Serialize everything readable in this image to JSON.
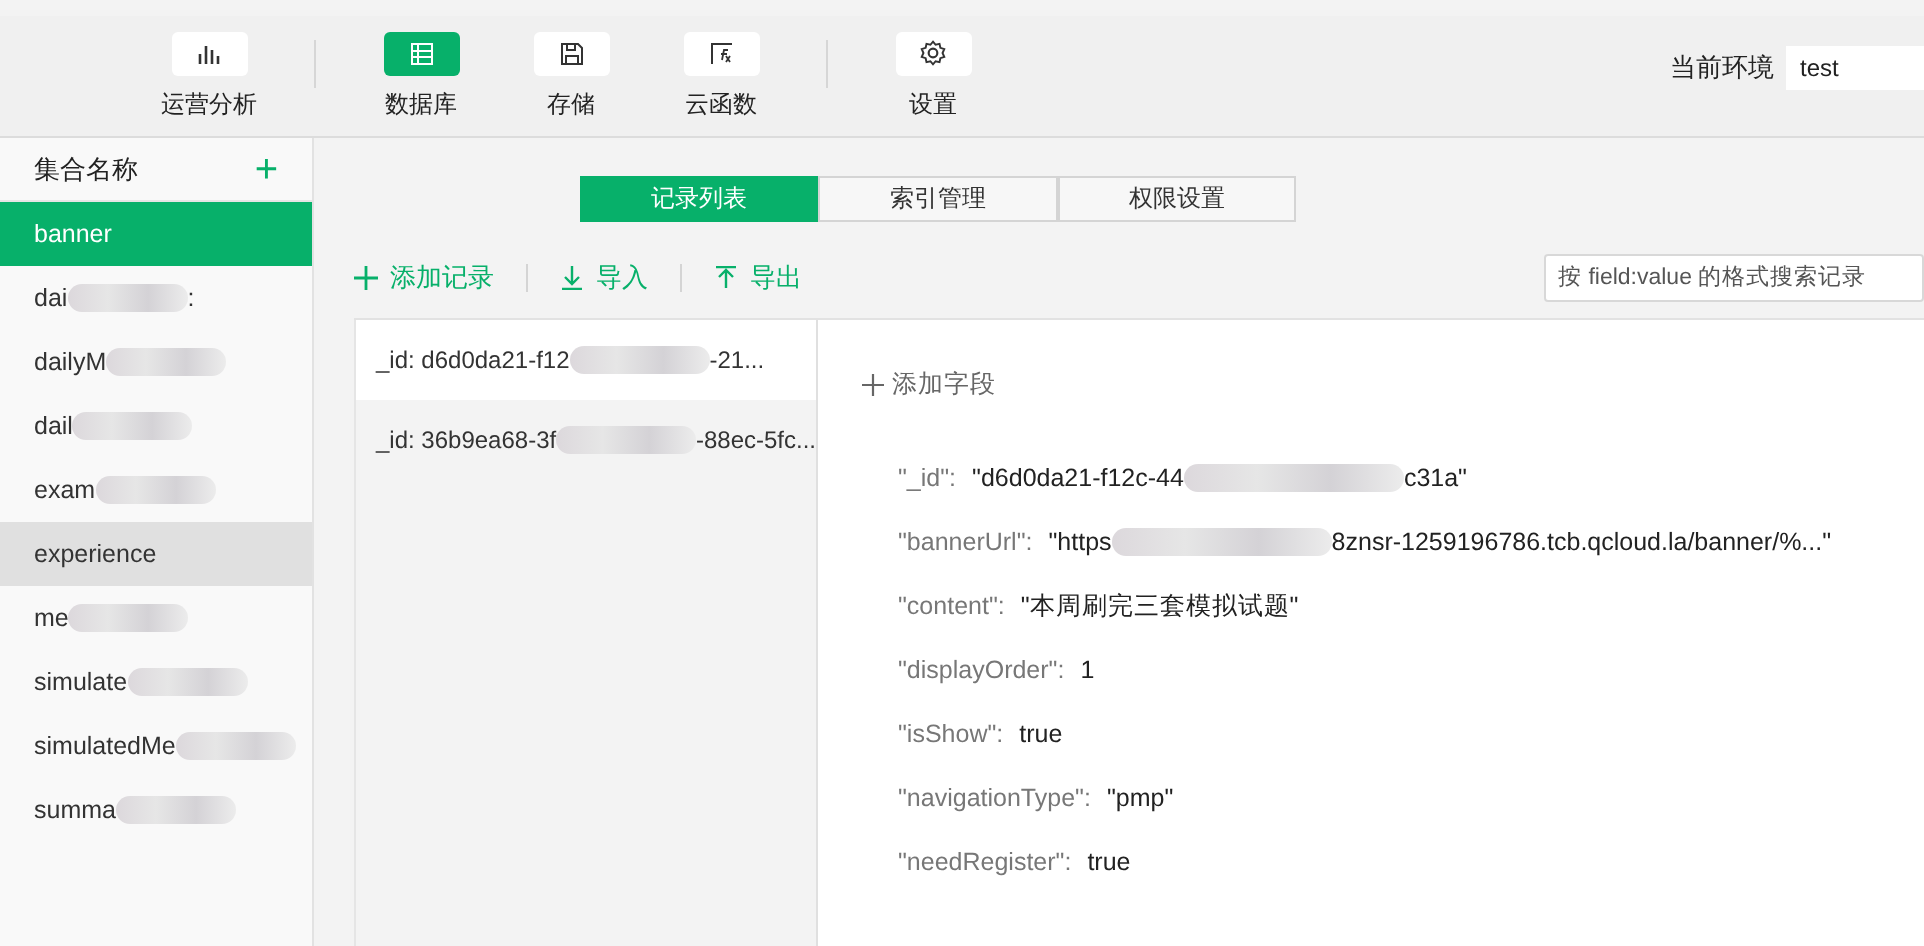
{
  "nav": [
    {
      "label": "运营分析",
      "kind": "chart",
      "selected": false
    },
    {
      "label": "数据库",
      "kind": "database",
      "selected": true
    },
    {
      "label": "存储",
      "kind": "storage",
      "selected": false
    },
    {
      "label": "云函数",
      "kind": "function",
      "selected": false
    },
    {
      "label": "设置",
      "kind": "settings",
      "selected": false
    }
  ],
  "environment": {
    "label": "当前环境",
    "value": "test"
  },
  "sidebar": {
    "title": "集合名称",
    "add": "+",
    "items": [
      {
        "before": "banner",
        "redacted": false,
        "selected": true,
        "hovered": false
      },
      {
        "before": "dai",
        "after": ":",
        "redacted": true,
        "selected": false,
        "hovered": false
      },
      {
        "before": "dailyM",
        "redacted": true,
        "selected": false,
        "hovered": false
      },
      {
        "before": "dail",
        "redacted": true,
        "selected": false,
        "hovered": false
      },
      {
        "before": "exam",
        "redacted": true,
        "selected": false,
        "hovered": false
      },
      {
        "before": "experience",
        "redacted": false,
        "selected": false,
        "hovered": true
      },
      {
        "before": "me",
        "redacted": true,
        "selected": false,
        "hovered": false
      },
      {
        "before": "simulate",
        "redacted": true,
        "selected": false,
        "hovered": false
      },
      {
        "before": "simulatedMe",
        "redacted": true,
        "selected": false,
        "hovered": false
      },
      {
        "before": "summa",
        "redacted": true,
        "selected": false,
        "hovered": false
      }
    ]
  },
  "tabs": [
    {
      "label": "记录列表",
      "selected": true
    },
    {
      "label": "索引管理",
      "selected": false
    },
    {
      "label": "权限设置",
      "selected": false
    }
  ],
  "toolbar": [
    {
      "label": "添加记录",
      "kind": "add"
    },
    {
      "label": "导入",
      "kind": "import"
    },
    {
      "label": "导出",
      "kind": "export"
    }
  ],
  "search": {
    "placeholder": "按 field:value 的格式搜索记录"
  },
  "records": [
    {
      "before": "_id: d6d0da21-f12",
      "after": "-21...",
      "selected": true
    },
    {
      "before": "_id: 36b9ea68-3f",
      "after": "-88ec-5fc...",
      "selected": false
    }
  ],
  "add_field": "添加字段",
  "fields": [
    {
      "key": "\"_id\":",
      "before": "\"d6d0da21-f12c-44",
      "after": "c31a\"",
      "redacted": true
    },
    {
      "key": "\"bannerUrl\":",
      "before": "\"https",
      "after": "8znsr-1259196786.tcb.qcloud.la/banner/%...\"",
      "redacted": true
    },
    {
      "key": "\"content\":",
      "before": "\"本周刷完三套模拟试题\"",
      "redacted": false
    },
    {
      "key": "\"displayOrder\":",
      "before": "1",
      "redacted": false
    },
    {
      "key": "\"isShow\":",
      "before": "true",
      "redacted": false
    },
    {
      "key": "\"navigationType\":",
      "before": "\"pmp\"",
      "redacted": false
    },
    {
      "key": "\"needRegister\":",
      "before": "true",
      "redacted": false
    }
  ]
}
